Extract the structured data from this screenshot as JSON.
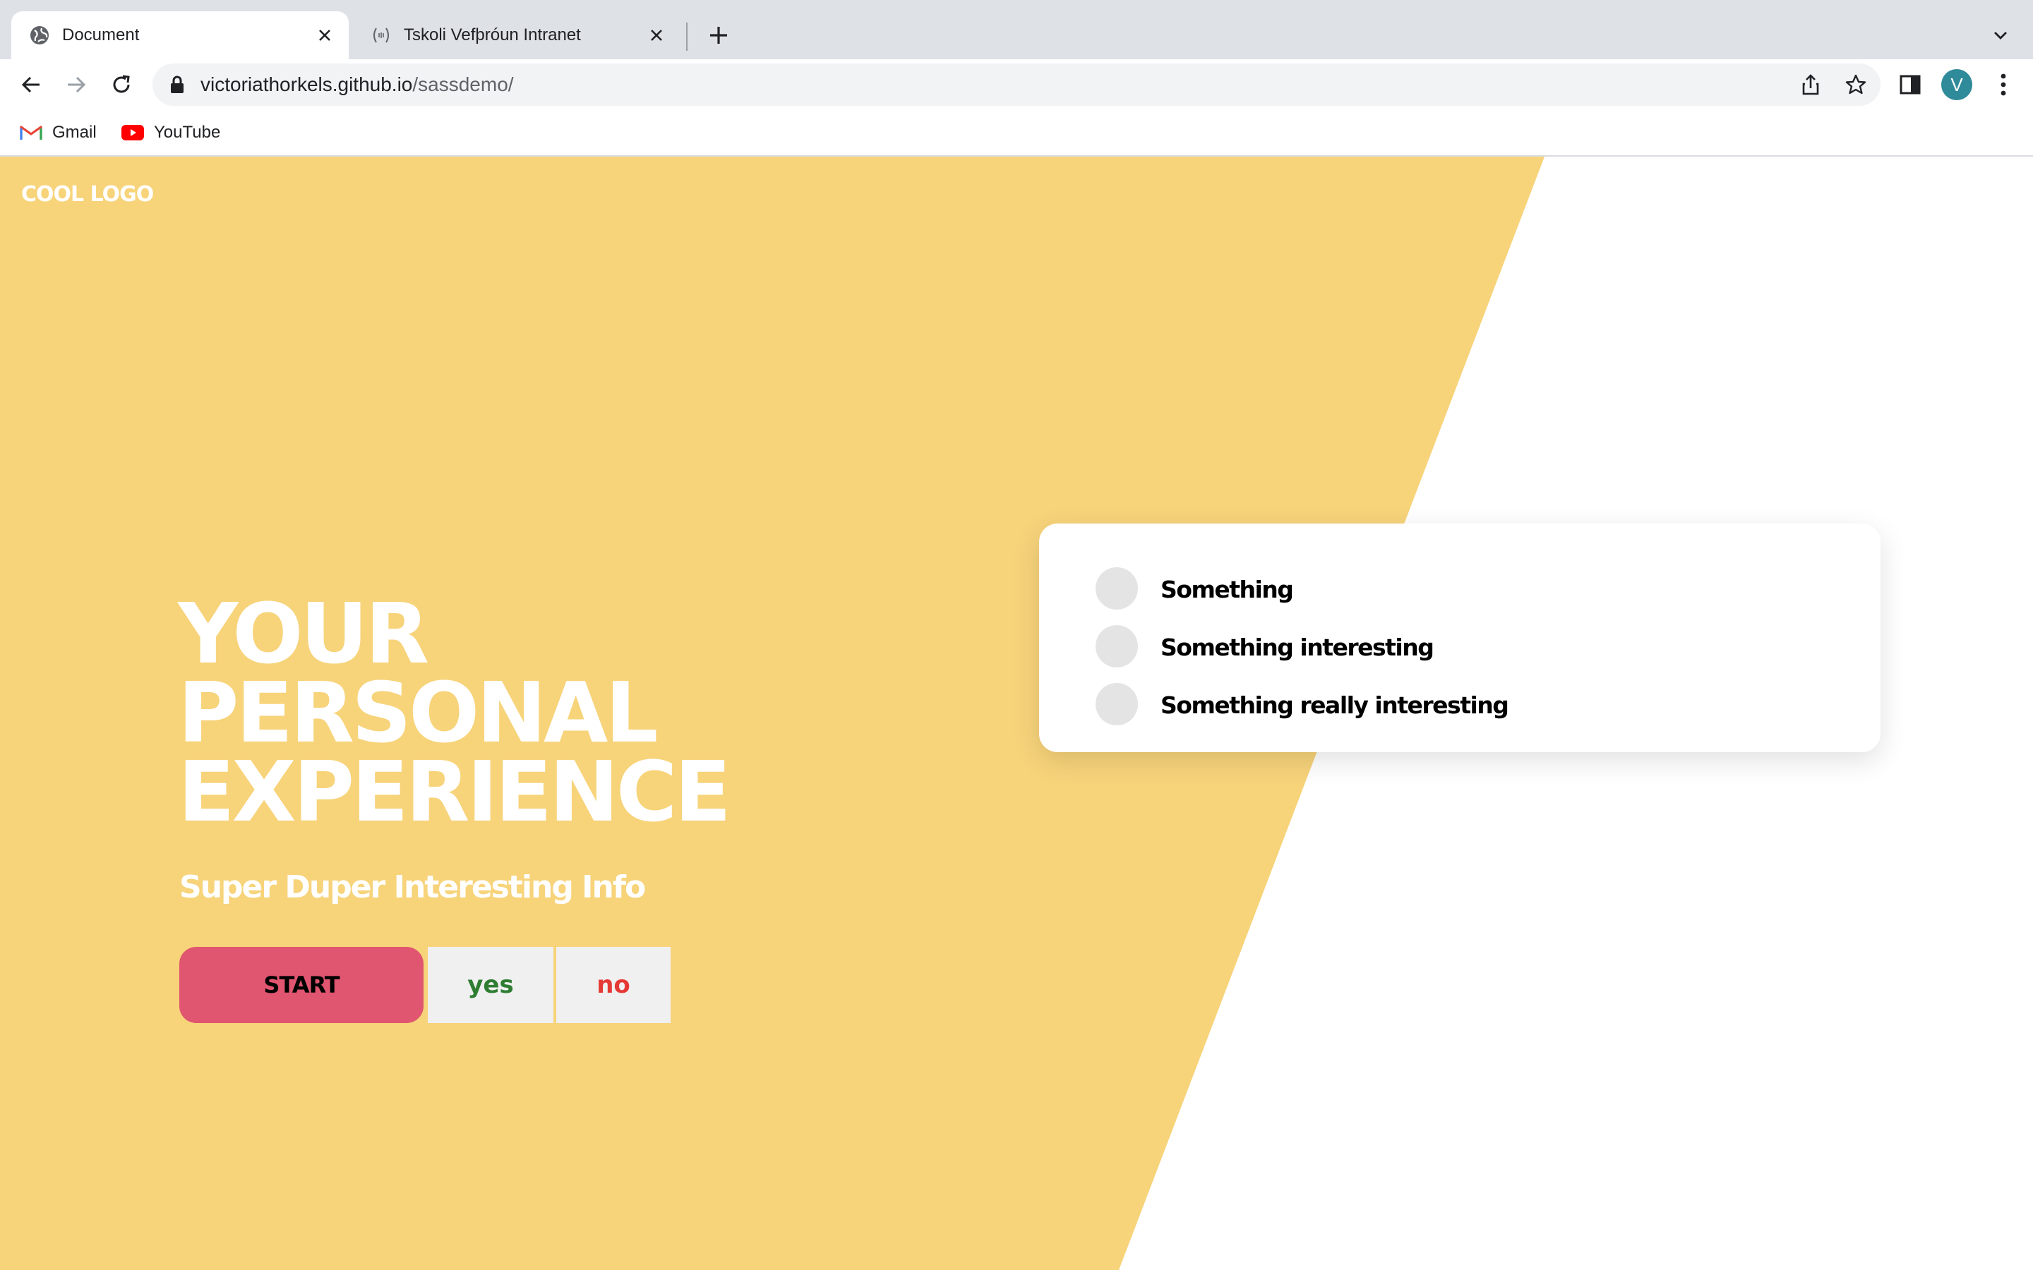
{
  "browser": {
    "tabs": [
      {
        "title": "Document",
        "active": true,
        "favicon": "globe-icon"
      },
      {
        "title": "Tskoli Vefþróun Intranet",
        "active": false,
        "favicon": "code-brackets-icon"
      }
    ],
    "url_host": "victoriathorkels.github.io",
    "url_path": "/sassdemo/",
    "profile_initial": "V",
    "profile_color": "#2f8a99",
    "bookmarks": [
      {
        "label": "Gmail",
        "icon": "gmail-icon"
      },
      {
        "label": "YouTube",
        "icon": "youtube-icon"
      }
    ]
  },
  "page": {
    "logo": "COOL LOGO",
    "hero_lines": [
      "YOUR",
      "PERSONAL",
      "EXPERIENCE"
    ],
    "subtitle": "Super Duper Interesting Info",
    "buttons": {
      "start": "START",
      "yes": "yes",
      "no": "no"
    },
    "card_items": [
      "Something",
      "Something interesting",
      "Something really interesting"
    ],
    "colors": {
      "background_yellow": "#f7d37a",
      "start_button": "#e05570",
      "yes_text": "#2e7d32",
      "no_text": "#e53935"
    }
  }
}
